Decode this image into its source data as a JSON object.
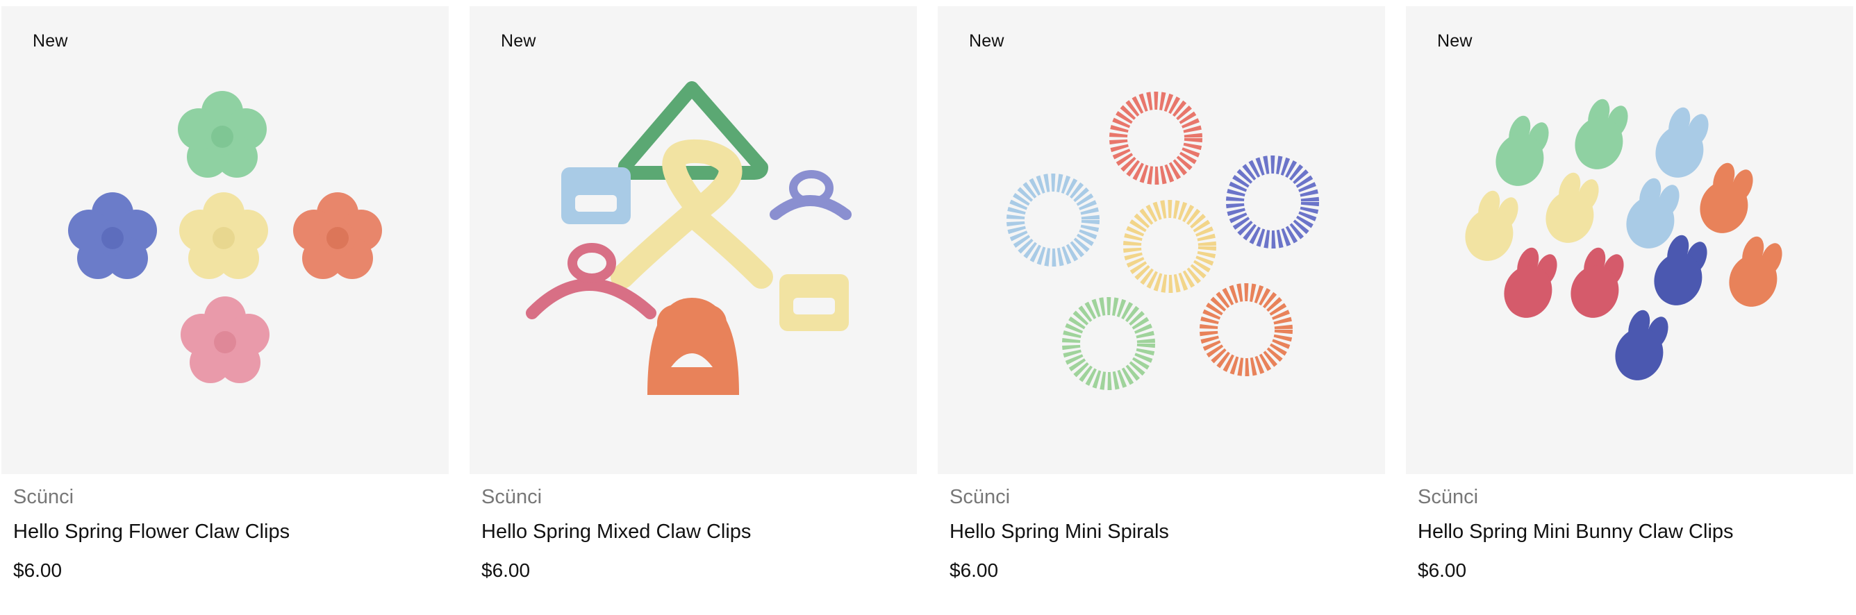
{
  "products": [
    {
      "badge": "New",
      "brand": "Scünci",
      "name": "Hello Spring Flower Claw Clips",
      "price": "$6.00",
      "image_icon": "flower-claw-clips"
    },
    {
      "badge": "New",
      "brand": "Scünci",
      "name": "Hello Spring Mixed Claw Clips",
      "price": "$6.00",
      "image_icon": "mixed-claw-clips"
    },
    {
      "badge": "New",
      "brand": "Scünci",
      "name": "Hello Spring Mini Spirals",
      "price": "$6.00",
      "image_icon": "spiral-hair-ties"
    },
    {
      "badge": "New",
      "brand": "Scünci",
      "name": "Hello Spring Mini Bunny Claw Clips",
      "price": "$6.00",
      "image_icon": "bunny-claw-clips"
    }
  ],
  "colors": {
    "image_bg": "#f5f5f5",
    "blue": "#6b7cc9",
    "green": "#8fd1a2",
    "yellow": "#f2e3a2",
    "coral": "#e8866b",
    "pink": "#e99aaa",
    "light_blue": "#a9cbe6",
    "lavender": "#8a8fd0",
    "dark_blue": "#4b58b0",
    "red": "#d55b6b",
    "orange": "#e8825a"
  }
}
